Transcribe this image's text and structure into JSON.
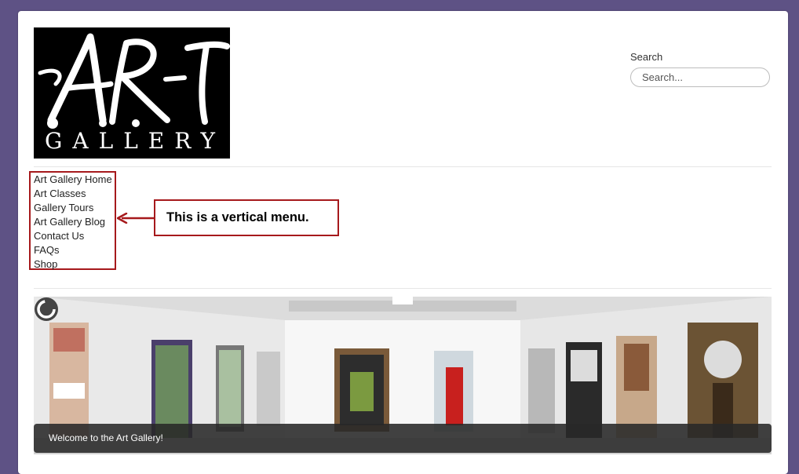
{
  "logo": {
    "art_text": "Art",
    "gallery_text": "GALLERY"
  },
  "search": {
    "label": "Search",
    "placeholder": "Search..."
  },
  "menu": {
    "items": [
      {
        "label": "Art Gallery Home"
      },
      {
        "label": "Art Classes"
      },
      {
        "label": "Gallery Tours"
      },
      {
        "label": "Art Gallery Blog"
      },
      {
        "label": "Contact Us"
      },
      {
        "label": "FAQs"
      },
      {
        "label": "Shop"
      }
    ]
  },
  "annotation": {
    "text": "This is a vertical menu.",
    "color": "#a6191c"
  },
  "slider": {
    "caption": "Welcome to the Art Gallery!"
  },
  "colors": {
    "background": "#5e5285",
    "annotation": "#a6191c"
  }
}
